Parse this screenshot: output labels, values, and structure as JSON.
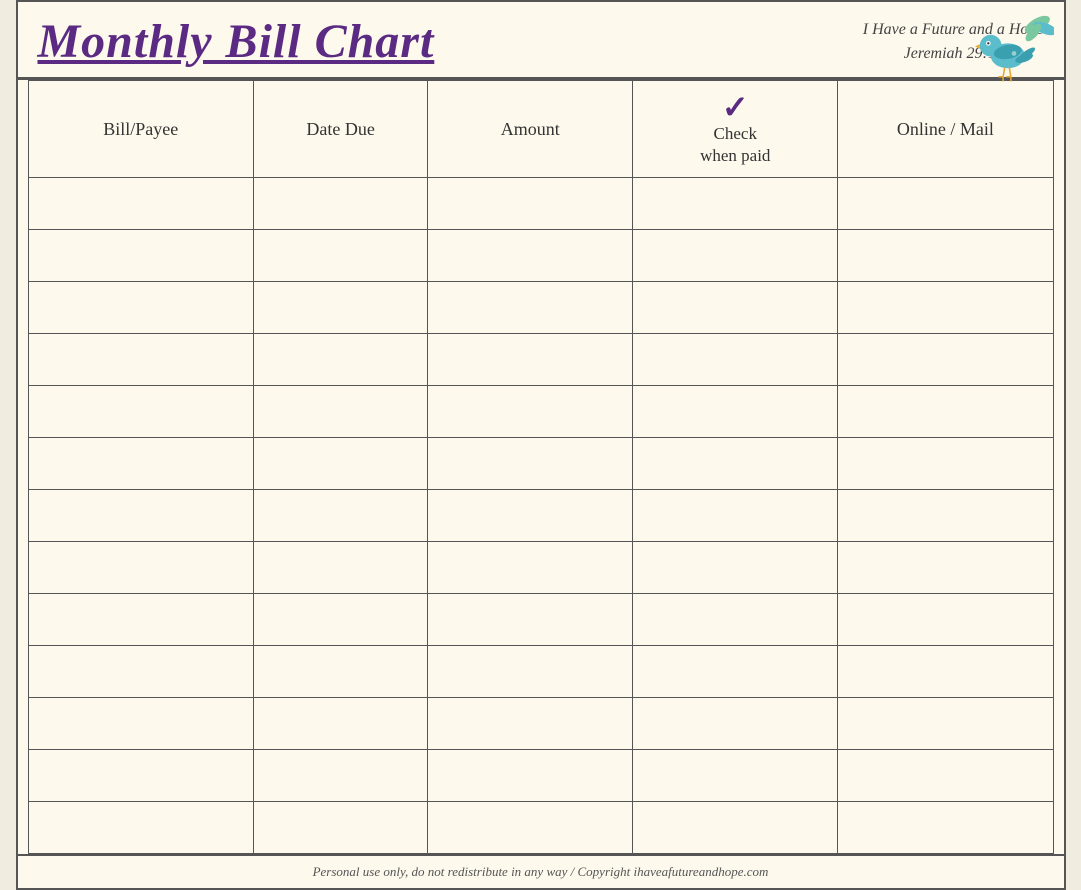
{
  "header": {
    "title": "Monthly Bill Chart",
    "tagline_line1": "I Have a Future and a Hope",
    "tagline_line2": "Jeremiah 29:11"
  },
  "table": {
    "columns": [
      {
        "id": "bill",
        "label": "Bill/Payee"
      },
      {
        "id": "date",
        "label": "Date Due"
      },
      {
        "id": "amount",
        "label": "Amount"
      },
      {
        "id": "check",
        "label": "Check\nwhen paid",
        "has_checkmark": true
      },
      {
        "id": "online",
        "label": "Online / Mail"
      }
    ],
    "row_count": 13
  },
  "footer": {
    "text": "Personal use only, do not redistribute in any way / Copyright ihaveafutureandhope.com"
  }
}
